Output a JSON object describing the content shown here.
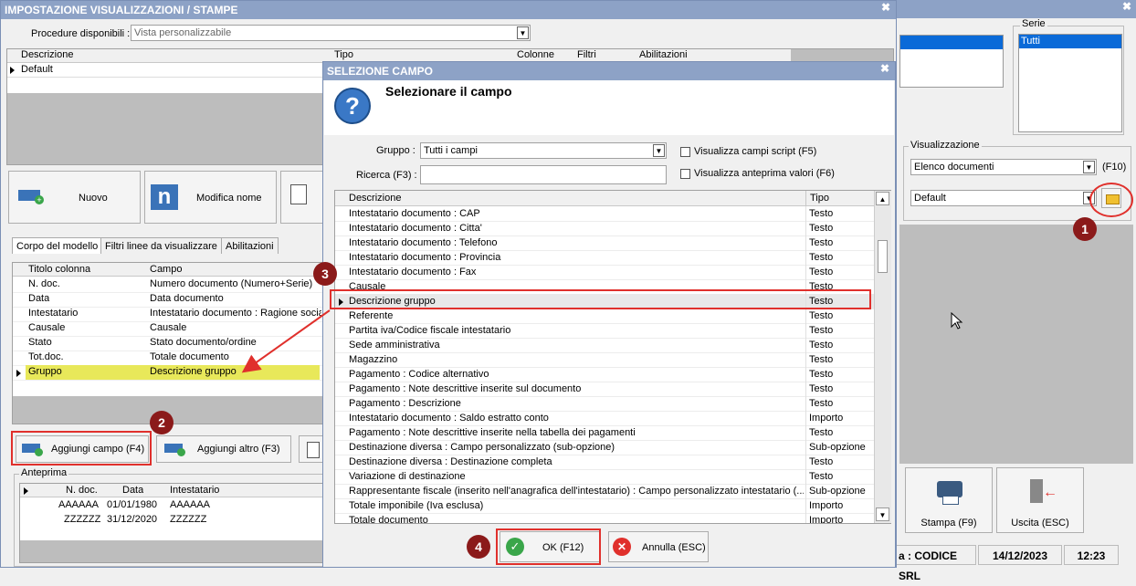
{
  "main_window": {
    "title": "IMPOSTAZIONE VISUALIZZAZIONI / STAMPE",
    "procedure_label": "Procedure disponibili :",
    "procedure_value": "Vista personalizzabile",
    "models_columns": [
      "Descrizione",
      "Tipo",
      "Colonne",
      "Filtri",
      "Abilitazioni"
    ],
    "models_rows": [
      {
        "descrizione": "Default"
      }
    ],
    "buttons": {
      "nuovo": "Nuovo",
      "modifica_nome": "Modifica nome"
    },
    "tabs": [
      "Corpo del modello",
      "Filtri linee da visualizzare",
      "Abilitazioni"
    ],
    "columns_header": [
      "Titolo colonna",
      "Campo"
    ],
    "columns_rows": [
      {
        "titolo": "N. doc.",
        "campo": "Numero documento (Numero+Serie)"
      },
      {
        "titolo": "Data",
        "campo": "Data documento"
      },
      {
        "titolo": "Intestatario",
        "campo": "Intestatario documento : Ragione socia"
      },
      {
        "titolo": "Causale",
        "campo": "Causale"
      },
      {
        "titolo": "Stato",
        "campo": "Stato documento/ordine"
      },
      {
        "titolo": "Tot.doc.",
        "campo": "Totale documento"
      },
      {
        "titolo": "Gruppo",
        "campo": "Descrizione gruppo"
      }
    ],
    "aggiungi_campo": "Aggiungi campo (F4)",
    "aggiungi_altro": "Aggiungi altro (F3)",
    "anteprima_label": "Anteprima",
    "preview_header": [
      "N. doc.",
      "Data",
      "Intestatario"
    ],
    "preview_rows": [
      {
        "ndoc": "AAAAAA",
        "data": "01/01/1980",
        "intestatario": "AAAAAA"
      },
      {
        "ndoc": "ZZZZZZ",
        "data": "31/12/2020",
        "intestatario": "ZZZZZZ"
      }
    ]
  },
  "back_window": {
    "serie_label": "Serie",
    "serie_value": "Tutti",
    "visualizzazione_label": "Visualizzazione",
    "vis_combo": "Elenco documenti",
    "f10_label": "(F10)",
    "default_combo": "Default",
    "stampa": "Stampa (F9)",
    "uscita": "Uscita (ESC)",
    "status_company": "a : CODICE SRL",
    "status_date": "14/12/2023",
    "status_time": "12:23"
  },
  "dialog": {
    "title": "SELEZIONE CAMPO",
    "heading": "Selezionare il campo",
    "gruppo_label": "Gruppo :",
    "gruppo_value": "Tutti i campi",
    "ricerca_label": "Ricerca (F3) :",
    "ricerca_value": "",
    "chk_script": "Visualizza campi script (F5)",
    "chk_anteprima": "Visualizza anteprima valori (F6)",
    "list_header": [
      "Descrizione",
      "Tipo"
    ],
    "list_rows": [
      {
        "d": "Intestatario documento : CAP",
        "t": "Testo"
      },
      {
        "d": "Intestatario documento : Citta'",
        "t": "Testo"
      },
      {
        "d": "Intestatario documento : Telefono",
        "t": "Testo"
      },
      {
        "d": "Intestatario documento : Provincia",
        "t": "Testo"
      },
      {
        "d": "Intestatario documento : Fax",
        "t": "Testo"
      },
      {
        "d": "Causale",
        "t": "Testo"
      },
      {
        "d": "Descrizione gruppo",
        "t": "Testo"
      },
      {
        "d": "Referente",
        "t": "Testo"
      },
      {
        "d": "Partita iva/Codice fiscale intestatario",
        "t": "Testo"
      },
      {
        "d": "Sede amministrativa",
        "t": "Testo"
      },
      {
        "d": "Magazzino",
        "t": "Testo"
      },
      {
        "d": "Pagamento : Codice alternativo",
        "t": "Testo"
      },
      {
        "d": "Pagamento : Note descrittive inserite sul documento",
        "t": "Testo"
      },
      {
        "d": "Pagamento : Descrizione",
        "t": "Testo"
      },
      {
        "d": "Intestatario documento : Saldo estratto conto",
        "t": "Importo"
      },
      {
        "d": "Pagamento : Note descrittive inserite nella tabella dei pagamenti",
        "t": "Testo"
      },
      {
        "d": "Destinazione diversa : Campo personalizzato (sub-opzione)",
        "t": "Sub-opzione"
      },
      {
        "d": "Destinazione diversa : Destinazione completa",
        "t": "Testo"
      },
      {
        "d": "Variazione di destinazione",
        "t": "Testo"
      },
      {
        "d": "Rappresentante fiscale (inserito nell'anagrafica dell'intestatario) : Campo personalizzato intestatario (...",
        "t": "Sub-opzione"
      },
      {
        "d": "Totale imponibile (Iva esclusa)",
        "t": "Importo"
      },
      {
        "d": "Totale documento",
        "t": "Importo"
      }
    ],
    "ok": "OK (F12)",
    "annulla": "Annulla (ESC)"
  },
  "annotations": [
    "1",
    "2",
    "3",
    "4"
  ],
  "colors": {
    "titlebar": "#8da2c6",
    "selected": "#0a6ad8",
    "highlight": "#e8e85a",
    "annotation_red": "#e0302c",
    "badge": "#8b1a1a"
  }
}
